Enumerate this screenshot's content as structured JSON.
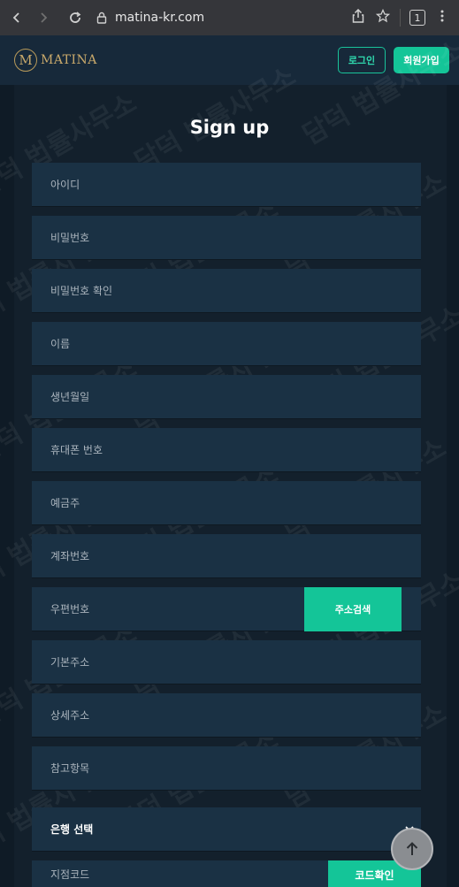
{
  "browser": {
    "url": "matina-kr.com",
    "tab_count": "1"
  },
  "header": {
    "logo_letter": "M",
    "logo_text": "MATINA",
    "login_label": "로그인",
    "signup_label": "회원가입"
  },
  "form": {
    "title": "Sign up",
    "fields": [
      {
        "label": "아이디"
      },
      {
        "label": "비밀번호"
      },
      {
        "label": "비밀번호 확인"
      },
      {
        "label": "이름"
      },
      {
        "label": "생년월일"
      },
      {
        "label": "휴대폰 번호"
      },
      {
        "label": "예금주"
      },
      {
        "label": "계좌번호"
      },
      {
        "label": "우편번호"
      },
      {
        "label": "기본주소"
      },
      {
        "label": "상세주소"
      },
      {
        "label": "참고항목"
      }
    ],
    "address_search_button": "주소검색",
    "bank_select": "은행 선택",
    "branch_code": "지점코드",
    "code_confirm_button": "코드확인"
  },
  "watermark_text": "담덕 법률사무소"
}
